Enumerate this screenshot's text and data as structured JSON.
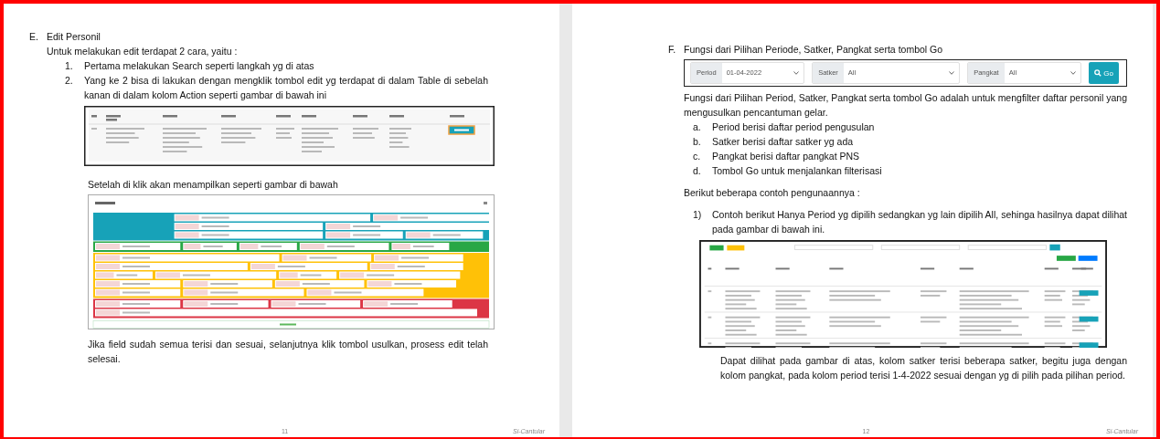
{
  "pages": [
    {
      "number": "11",
      "footer": "Si-Cantular",
      "blocks": [
        {
          "kind": "heading",
          "marker": "E.",
          "text": "Edit Personil"
        },
        {
          "kind": "para",
          "text": "Untuk melakukan edit terdapat 2 cara, yaitu :"
        },
        {
          "kind": "item",
          "marker": "1.",
          "text": "Pertama melakukan Search seperti langkah yg di atas"
        },
        {
          "kind": "item",
          "marker": "2.",
          "text": "Yang ke 2 bisa di lakukan dengan mengklik tombol edit yg terdapat di dalam Table di sebelah kanan di dalam kolom Action seperti gambar di bawah ini"
        },
        {
          "kind": "table_shot"
        },
        {
          "kind": "item_text",
          "text": "Setelah di klik akan menampilkan seperti gambar di bawah"
        },
        {
          "kind": "form_shot"
        },
        {
          "kind": "item_text",
          "text": "Jika field sudah semua terisi dan sesuai, selanjutnya klik tombol usulkan, prosess edit telah selesai."
        }
      ]
    },
    {
      "number": "12",
      "footer": "Si-Cantular",
      "blocks": [
        {
          "kind": "heading",
          "marker": "F.",
          "text": "Fungsi dari Pilihan Periode, Satker, Pangkat serta tombol Go"
        },
        {
          "kind": "filter_shot",
          "filters": [
            {
              "label": "Period",
              "value": "01-04-2022"
            },
            {
              "label": "Satker",
              "value": "All"
            },
            {
              "label": "Pangkat",
              "value": "All"
            }
          ],
          "button": "Go"
        },
        {
          "kind": "para",
          "text": "Fungsi dari Pilihan Period, Satker, Pangkat serta tombol Go adalah untuk mengfilter daftar personil yang mengusulkan pencantuman gelar."
        },
        {
          "kind": "item",
          "marker": "a.",
          "text": "Period berisi daftar period pengusulan"
        },
        {
          "kind": "item",
          "marker": "b.",
          "text": "Satker berisi daftar satker yg ada"
        },
        {
          "kind": "item",
          "marker": "c.",
          "text": "Pangkat berisi daftar pangkat PNS"
        },
        {
          "kind": "item",
          "marker": "d.",
          "text": "Tombol Go untuk menjalankan filterisasi"
        },
        {
          "kind": "para",
          "text": "Berikut beberapa contoh pengunaannya :"
        },
        {
          "kind": "item",
          "marker": "1)",
          "text": "Contoh berikut Hanya Period yg dipilih sedangkan yg lain dipilih All, sehinga hasilnya dapat dilihat pada gambar di bawah ini."
        },
        {
          "kind": "list_shot"
        },
        {
          "kind": "item_text",
          "text": "Dapat dilihat pada gambar di atas, kolom satker terisi beberapa satker, begitu juga dengan kolom pangkat, pada kolom period terisi 1-4-2022 sesuai dengan yg di pilih pada pilihan period."
        }
      ]
    }
  ]
}
